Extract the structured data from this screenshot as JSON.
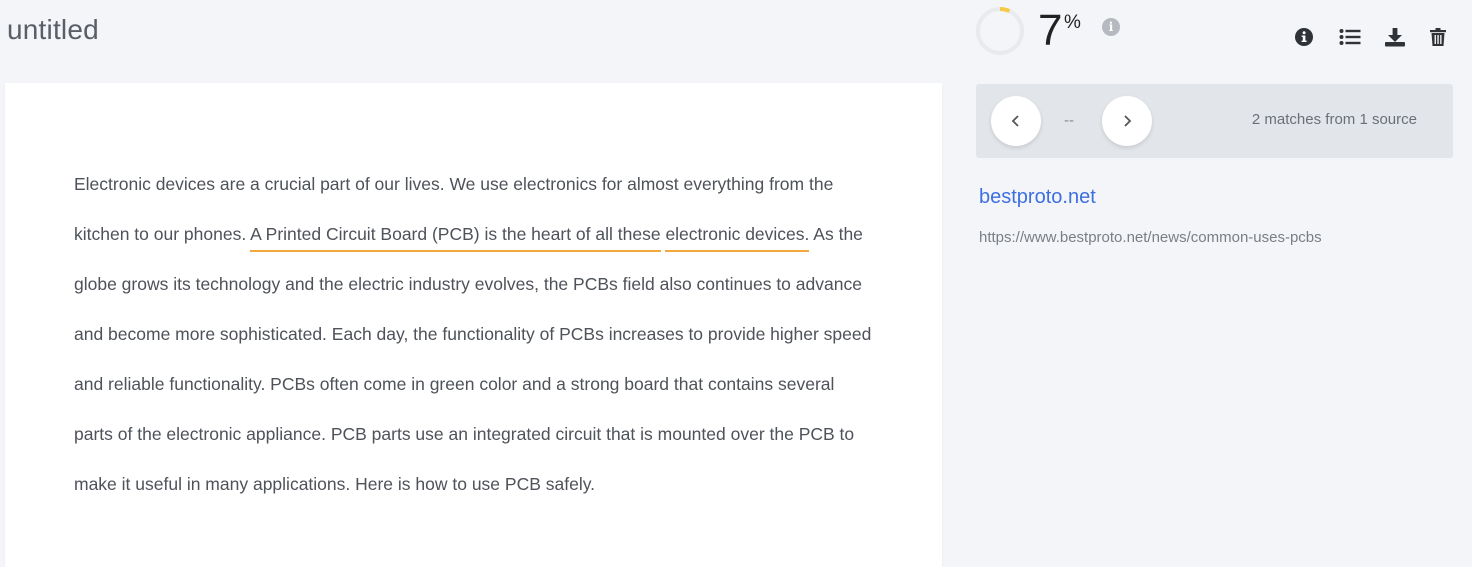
{
  "document": {
    "title": "untitled",
    "paragraph": {
      "before_match": "Electronic devices are a crucial part of our lives. We use electronics for almost everything from the kitchen to our phones. ",
      "match_1_line1": "A Printed Circuit Board (PCB) is the heart of all these",
      "match_1_line2": "electronic devices.",
      "after_match": " As the globe grows its technology and the electric industry evolves, the PCBs field also continues to advance and become more sophisticated. Each day, the functionality of PCBs increases to provide higher speed and reliable functionality. PCBs often come in green color and a strong board that contains several parts of the electronic appliance. PCB parts use an integrated circuit that is mounted over the PCB to make it useful in many applications. Here is how to use PCB safely."
    },
    "highlight_color": "#f2a93b"
  },
  "score": {
    "value": "7",
    "unit": "%",
    "fraction": 0.07,
    "ring_color": "#f7c948",
    "info_icon": "info-icon"
  },
  "toolbar": {
    "items": [
      {
        "name": "info-button",
        "icon": "info-circle-icon"
      },
      {
        "name": "list-button",
        "icon": "list-icon"
      },
      {
        "name": "download-button",
        "icon": "download-icon"
      },
      {
        "name": "delete-button",
        "icon": "trash-icon"
      }
    ]
  },
  "matches": {
    "prev_icon": "chevron-left-icon",
    "next_icon": "chevron-right-icon",
    "indicator": "--",
    "summary": "2 matches from 1 source"
  },
  "source": {
    "name": "bestproto.net",
    "url": "https://www.bestproto.net/news/common-uses-pcbs",
    "link_color": "#3d6fe0"
  }
}
